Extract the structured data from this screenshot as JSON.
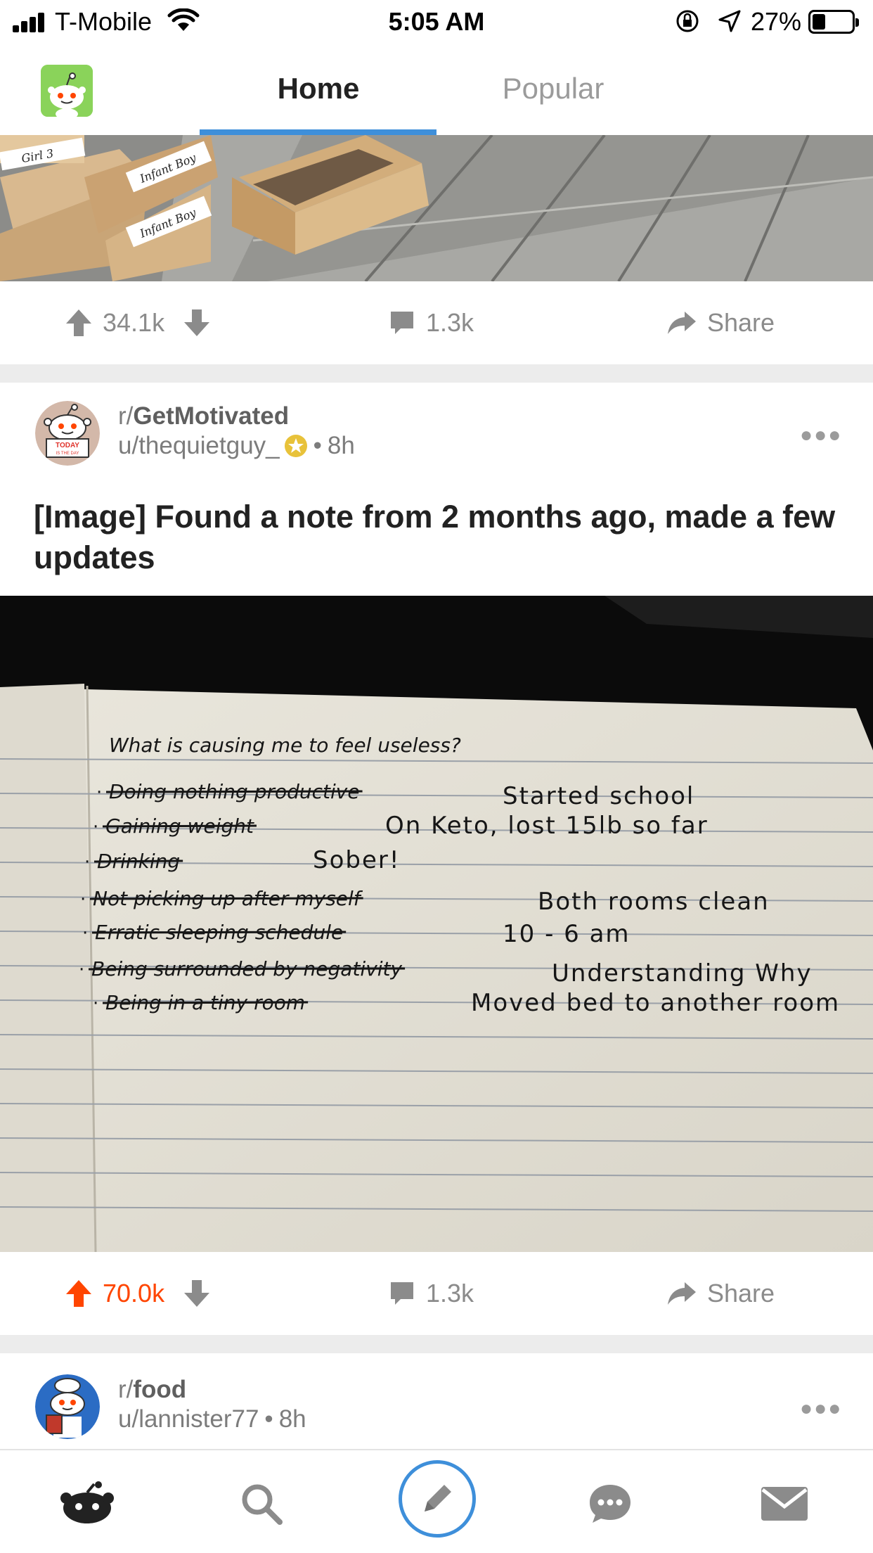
{
  "status_bar": {
    "carrier": "T-Mobile",
    "time": "5:05 AM",
    "battery": "27%"
  },
  "nav": {
    "tabs": [
      "Home",
      "Popular"
    ],
    "active_tab": "Home"
  },
  "prev_post": {
    "box_labels": [
      "Girl 3",
      "Infant Boy",
      "Infant Boy"
    ],
    "upvotes": "34.1k",
    "comments": "1.3k",
    "share_label": "Share"
  },
  "post": {
    "subreddit_prefix": "r/",
    "subreddit": "GetMotivated",
    "username": "u/thequietguy_",
    "age": "8h",
    "avatar_sign_top": "TODAY",
    "avatar_sign_bottom": "IS THE DAY",
    "title": "[Image] Found a note from 2 months ago, made a few updates",
    "note": {
      "heading": "What is causing me to feel useless?",
      "items": [
        {
          "crossed": "Doing nothing productive",
          "update": "Started school"
        },
        {
          "crossed": "Gaining weight",
          "update": "On Keto, lost 15lb so far"
        },
        {
          "crossed": "Drinking",
          "update": "Sober!"
        },
        {
          "crossed": "Not picking up after myself",
          "update": "Both rooms clean"
        },
        {
          "crossed": "Erratic sleeping schedule",
          "update": "10 - 6 am"
        },
        {
          "crossed": "Being surrounded by negativity",
          "update": "Understanding Why"
        },
        {
          "crossed": "Being in a tiny room",
          "update": "Moved bed to another room"
        }
      ]
    },
    "upvotes": "70.0k",
    "comments": "1.3k",
    "share_label": "Share"
  },
  "next_post": {
    "subreddit_prefix": "r/",
    "subreddit": "food",
    "username": "u/lannister77",
    "age": "8h"
  },
  "colors": {
    "accent_blue": "#3e8fda",
    "upvote_orange": "#ff4500",
    "snoo_green": "#8ad35a",
    "muted_gray": "#8b8b8b"
  }
}
